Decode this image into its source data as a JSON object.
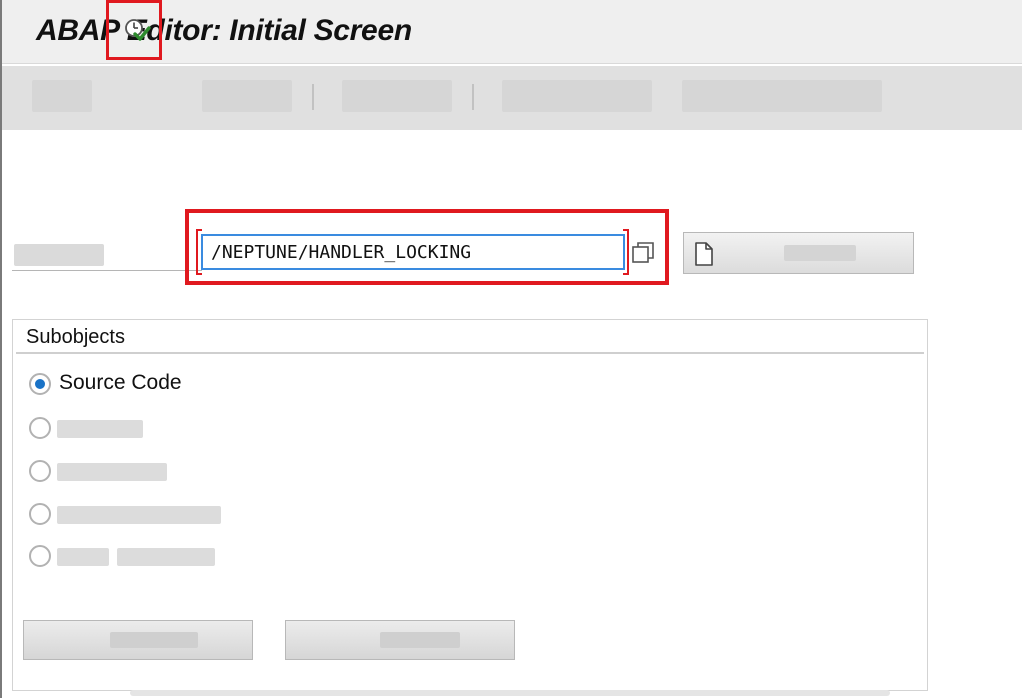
{
  "window": {
    "title": "ABAP Editor: Initial Screen"
  },
  "toolbar": {
    "execute_icon": "clock-check-icon"
  },
  "program": {
    "value": "/NEPTUNE/HANDLER_LOCKING",
    "copy_icon": "copy-icon",
    "create_icon": "document-icon"
  },
  "subobjects": {
    "title": "Subobjects",
    "options": [
      {
        "label": "Source Code",
        "selected": true
      },
      {
        "label": "",
        "selected": false
      },
      {
        "label": "",
        "selected": false
      },
      {
        "label": "",
        "selected": false
      },
      {
        "label": "",
        "selected": false
      }
    ]
  },
  "colors": {
    "highlight": "#e0191f",
    "input_focus": "#3a8be0",
    "radio_selected": "#1a73c7"
  }
}
